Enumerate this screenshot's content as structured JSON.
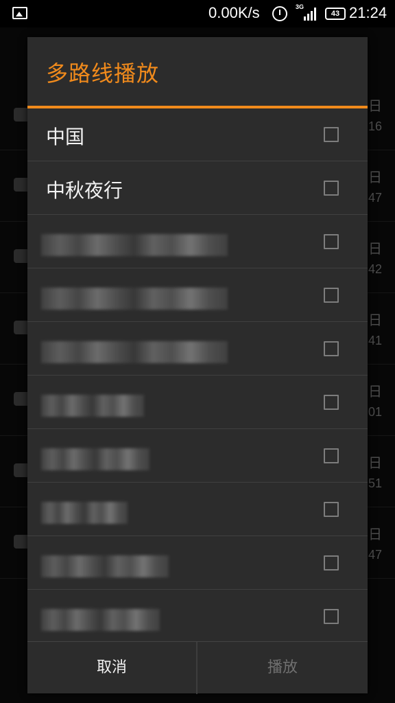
{
  "status_bar": {
    "network_speed": "0.00K/s",
    "network_type": "3G",
    "battery": "43",
    "time": "21:24",
    "icons": [
      "image-notification-icon",
      "alarm-icon",
      "signal-icon",
      "battery-icon"
    ]
  },
  "background_list": {
    "rows": [
      {
        "right_top": "日",
        "right_bottom": "16"
      },
      {
        "right_top": "日",
        "right_bottom": "47"
      },
      {
        "right_top": "日",
        "right_bottom": "42"
      },
      {
        "right_top": "日",
        "right_bottom": "41"
      },
      {
        "right_top": "日",
        "right_bottom": "01"
      },
      {
        "right_top": "日",
        "right_bottom": "51"
      },
      {
        "right_top": "日",
        "right_bottom": "47"
      }
    ]
  },
  "dialog": {
    "title": "多路线播放",
    "items": [
      {
        "label": "中国",
        "checked": false
      },
      {
        "label": "中秋夜行",
        "checked": false
      },
      {
        "label": "",
        "checked": false,
        "obscured": true
      },
      {
        "label": "",
        "checked": false,
        "obscured": true
      },
      {
        "label": "",
        "checked": false,
        "obscured": true
      },
      {
        "label": "",
        "checked": false,
        "obscured": true
      },
      {
        "label": "",
        "checked": false,
        "obscured": true
      },
      {
        "label": "",
        "checked": false,
        "obscured": true
      },
      {
        "label": "",
        "checked": false,
        "obscured": true
      },
      {
        "label": "",
        "checked": false,
        "obscured": true
      }
    ],
    "cancel_label": "取消",
    "play_label": "播放",
    "accent_color": "#f08a1c"
  }
}
